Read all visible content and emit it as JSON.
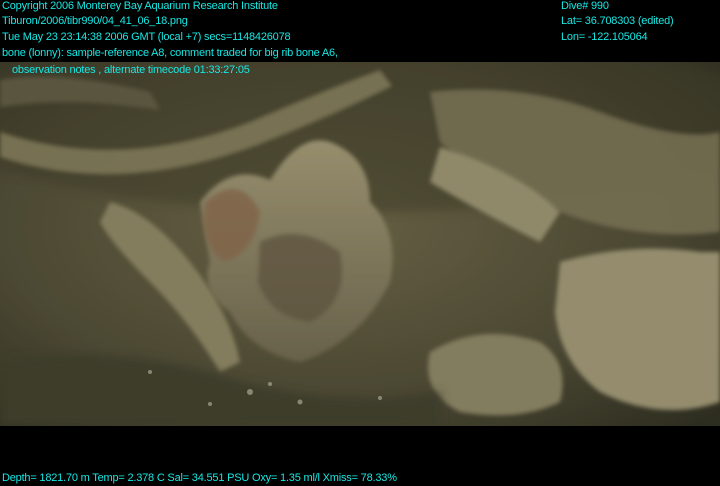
{
  "overlay": {
    "copyright": "Copyright 2006 Monterey Bay Aquarium Research Institute",
    "file_path": "Tiburon/2006/tibr990/04_41_06_18.png",
    "timestamp": "Tue May 23 23:14:38 2006 GMT (local +7)  secs=1148426078",
    "annotation_line1": "bone (lonny): sample-reference A8, comment traded for big rib bone A6,",
    "annotation_line2": "observation notes , alternate timecode 01:33:27:05",
    "dive": "Dive# 990",
    "lat": "Lat= 36.708303 (edited)",
    "lon": "Lon= -122.105064",
    "telemetry": "Depth= 1821.70 m  Temp= 2.378 C  Sal= 34.551 PSU  Oxy= 1.35 ml/l  Xmiss= 78.33%"
  },
  "colors": {
    "overlay_text": "#17e8e4",
    "background": "#000000"
  }
}
